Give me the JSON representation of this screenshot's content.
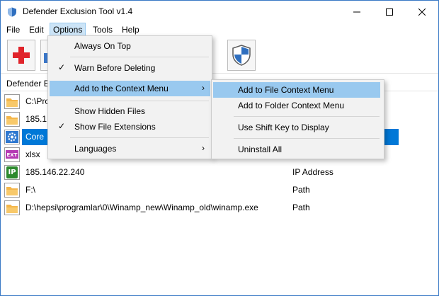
{
  "window": {
    "title": "Defender Exclusion Tool v1.4"
  },
  "menubar": {
    "file": "File",
    "edit": "Edit",
    "options": "Options",
    "tools": "Tools",
    "help": "Help"
  },
  "list": {
    "header_path": "Defender E",
    "rows": [
      {
        "path": "C:\\Pro",
        "type": "",
        "icon": "folder-icon"
      },
      {
        "path": "185.1",
        "type": "",
        "icon": "folder-icon"
      },
      {
        "path": "Core",
        "type": "",
        "icon": "gear-icon",
        "selected": true
      },
      {
        "path": "xlsx",
        "type": "",
        "icon": "ext-icon"
      },
      {
        "path": "185.146.22.240",
        "type": "IP Address",
        "icon": "ip-icon"
      },
      {
        "path": "F:\\",
        "type": "Path",
        "icon": "folder-icon"
      },
      {
        "path": "D:\\hepsi\\programlar\\0\\Winamp_new\\Winamp_old\\winamp.exe",
        "type": "Path",
        "icon": "folder-icon"
      }
    ]
  },
  "options_menu": {
    "always_on_top": "Always On Top",
    "warn_before_deleting": "Warn Before Deleting",
    "add_to_context_menu": "Add to the Context Menu",
    "show_hidden_files": "Show Hidden Files",
    "show_file_extensions": "Show File Extensions",
    "languages": "Languages"
  },
  "context_submenu": {
    "add_to_file": "Add to File Context Menu",
    "add_to_folder": "Add to Folder Context Menu",
    "use_shift_key": "Use Shift Key to Display",
    "uninstall_all": "Uninstall All"
  },
  "icons": {
    "check": "✓",
    "submenu_arrow": "›",
    "ext_badge": "EXT",
    "ip_badge": "IP"
  },
  "colors": {
    "selection": "#0078d7",
    "menu_highlight": "#99c9ef",
    "accent_border": "#3a79c6"
  }
}
